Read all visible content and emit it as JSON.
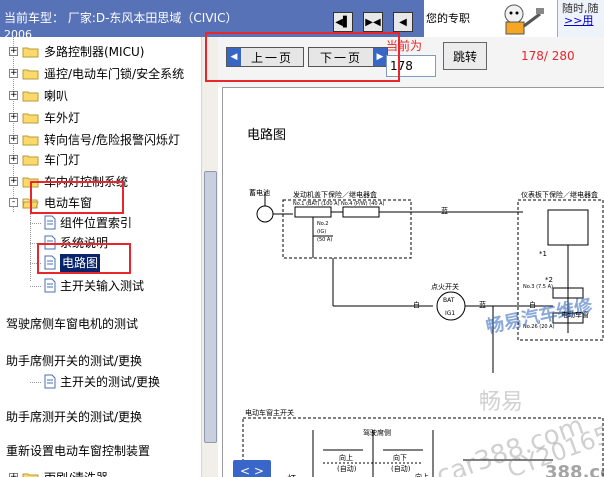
{
  "header": {
    "car_title": "当前车型： 厂家:D-东风本田思域（CIVIC）",
    "car_title_year": "2006",
    "nav_icons": [
      "nav-first-icon",
      "nav-double-icon",
      "nav-back-icon"
    ],
    "expert_label": "您的专职",
    "expert_box_line1": "随时,随",
    "expert_box_line2": ">>用"
  },
  "tree": {
    "items": [
      {
        "label": "多路控制器(MICU)",
        "kind": "folder",
        "toggle": "+"
      },
      {
        "label": "遥控/电动车门锁/安全系统",
        "kind": "folder",
        "toggle": "+"
      },
      {
        "label": "喇叭",
        "kind": "folder",
        "toggle": "+"
      },
      {
        "label": "车外灯",
        "kind": "folder",
        "toggle": "+"
      },
      {
        "label": "转向信号/危险报警闪烁灯",
        "kind": "folder",
        "toggle": "+"
      },
      {
        "label": "车门灯",
        "kind": "folder",
        "toggle": "+"
      },
      {
        "label": "车内灯控制系统",
        "kind": "folder",
        "toggle": "+"
      },
      {
        "label": "电动车窗",
        "kind": "folder-open",
        "toggle": "-"
      },
      {
        "label": "组件位置索引",
        "kind": "page"
      },
      {
        "label": "系统说明",
        "kind": "page"
      },
      {
        "label": "电路图",
        "kind": "page",
        "selected": true
      },
      {
        "label": "主开关输入测试",
        "kind": "page"
      },
      {
        "label": "驾驶席侧车窗电机的测试",
        "kind": "text"
      },
      {
        "label": "助手席侧开关的测试/更换",
        "kind": "text"
      },
      {
        "label": "主开关的测试/更换",
        "kind": "page"
      },
      {
        "label": "助手席测开关的测试/更换",
        "kind": "text"
      },
      {
        "label": "重新设置电动车窗控制装置",
        "kind": "text"
      },
      {
        "label": "雨刷/清洗器",
        "kind": "folder",
        "toggle": "+"
      }
    ]
  },
  "viewer": {
    "prev_label": "上一页",
    "next_label": "下一页",
    "current_label": "当前为",
    "current_page": "178",
    "jump_label": "跳转",
    "page_count": "178/ 280",
    "corner_nav": "< >"
  },
  "diagram": {
    "title": "电路图",
    "labels": {
      "battery": "蓄电池",
      "hood_box": "发动机盖下保险／继电器盒",
      "fuse1": "No.1 (BAT) (100 A)",
      "fuse4": "No.4 (P/W) (40 A)",
      "fuse2": "No.2",
      "ig": "(IG)",
      "amp50": "(50 A)",
      "dash_box": "仪表板下保险／继电器盒",
      "ign_switch": "点火开关",
      "blue1": "蓝",
      "blue2": "蓝",
      "white1": "白",
      "white2": "白",
      "bat": "BAT",
      "ig1": "IG1",
      "fuse3": "No.3 (7.5 A)",
      "fuse26": "No.26 (20 A)",
      "star1": "*1",
      "star2": "*2",
      "relay": "电动车窗",
      "main_switch": "电动车窗主开关",
      "driver_side": "驾驶席侧",
      "up1": "向上",
      "auto1": "(自动)",
      "down1": "向下",
      "auto2": "(自动)",
      "up2": "向上",
      "lamp": "灯"
    },
    "watermarks": {
      "brand_blue": "畅易汽车维修",
      "brand_grey": "畅易",
      "site": "car388.com",
      "id": "CY20165",
      "site2": "388.com"
    }
  },
  "colors": {
    "header_bg": "#5872b8",
    "highlight": "#e8262c",
    "selected_bg": "#0a246a",
    "button_blue": "#3866c4"
  }
}
